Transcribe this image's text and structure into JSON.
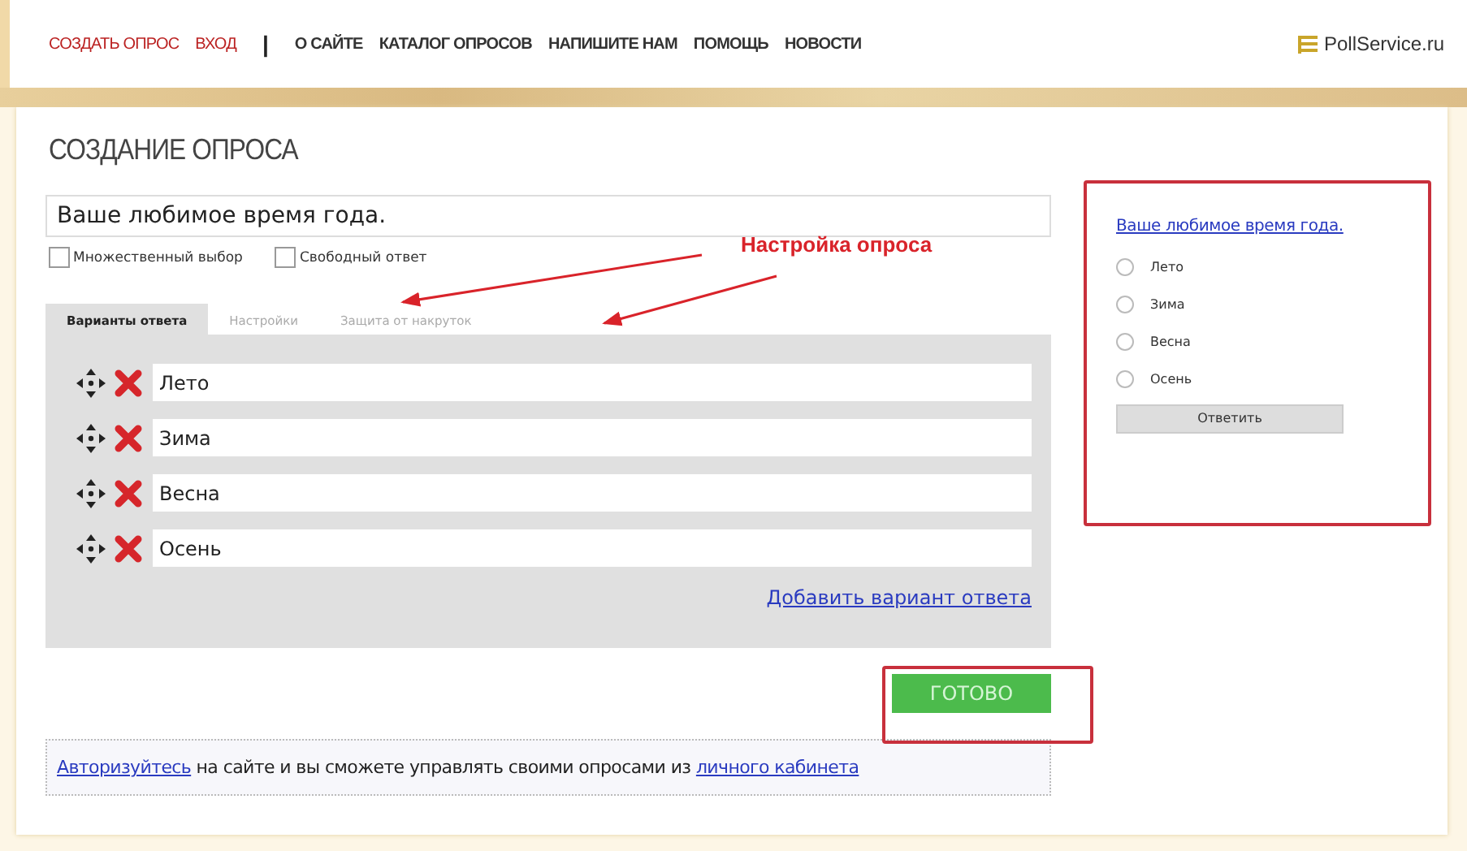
{
  "nav": [
    {
      "label": "СОЗДАТЬ ОПРОС",
      "kind": "account"
    },
    {
      "label": "ВХОД",
      "kind": "account"
    },
    {
      "label": "|",
      "kind": "separator"
    },
    {
      "label": "О САЙТЕ",
      "kind": "section"
    },
    {
      "label": "КАТАЛОГ ОПРОСОВ",
      "kind": "section"
    },
    {
      "label": "НАПИШИТЕ НАМ",
      "kind": "section"
    },
    {
      "label": "ПОМОЩЬ",
      "kind": "section"
    },
    {
      "label": "НОВОСТИ",
      "kind": "section"
    }
  ],
  "brand": "PollService.ru",
  "page_title": "СОЗДАНИЕ ОПРОСА",
  "question": {
    "value": "Ваше любимое время года."
  },
  "options_checkboxes": [
    {
      "label": "Множественный выбор",
      "checked": false
    },
    {
      "label": "Свободный ответ",
      "checked": false
    }
  ],
  "tabs": [
    {
      "label": "Варианты ответа",
      "selected": true
    },
    {
      "label": "Настройки",
      "selected": false
    },
    {
      "label": "Защита от накруток",
      "selected": false
    }
  ],
  "answers": [
    {
      "value": "Лето"
    },
    {
      "value": "Зима"
    },
    {
      "value": "Весна"
    },
    {
      "value": "Осень"
    }
  ],
  "add_answer_link": "Добавить вариант ответа",
  "done_button": "ГОТОВО",
  "notice": {
    "link": "Авторизуйтесь",
    "text": " на сайте и вы сможете управлять своими опросами из ",
    "link_2": "личного кабинета"
  },
  "annotation": "Настройка опроса",
  "preview": {
    "title": "Ваше любимое время года.",
    "options": [
      {
        "label": "Лето",
        "selected": false
      },
      {
        "label": "Зима",
        "selected": false
      },
      {
        "label": "Весна",
        "selected": false
      },
      {
        "label": "Осень",
        "selected": false
      }
    ],
    "button": "Ответить"
  }
}
